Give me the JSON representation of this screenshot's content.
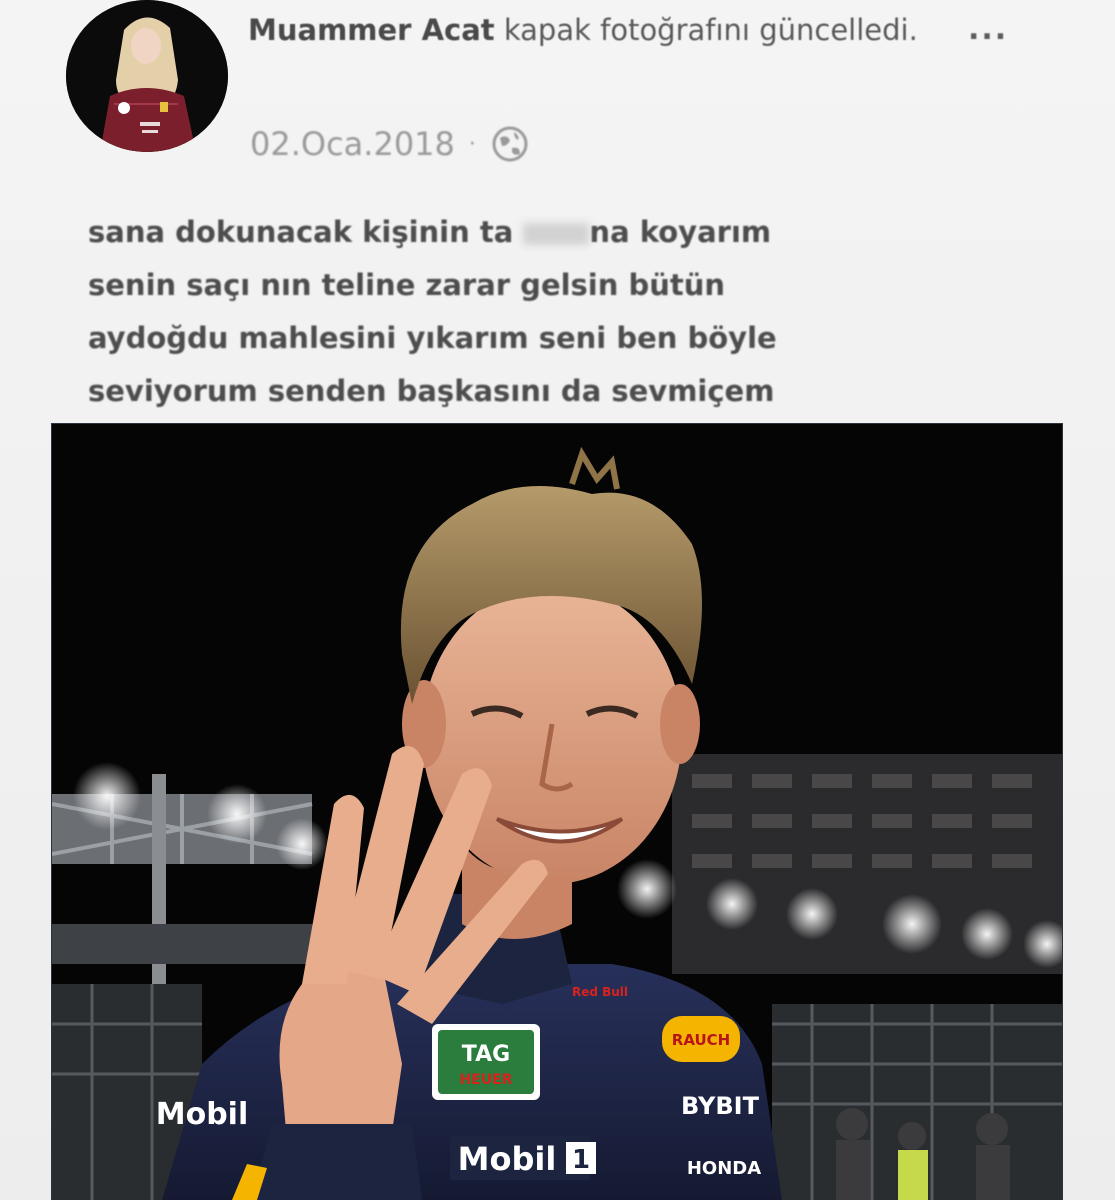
{
  "post": {
    "author": "Muammer Acat",
    "action": "kapak fotoğrafını güncelledi.",
    "more": "...",
    "date": "02.Oca.2018",
    "separator": "·",
    "audience_icon": "globe-icon",
    "text_lines": [
      "sana dokunacak kişinin ta",
      "na koyarım",
      "senin saçı nın teline zarar gelsin  bütün",
      "aydoğdu mahlesini  yıkarım seni ben böyle",
      "seviyorum senden başkasını da sevmiçem"
    ]
  },
  "photo": {
    "alt": "cover-photo",
    "suit_logos": {
      "tag": "TAG",
      "heuer": "HEUER",
      "mobil": "Mobil",
      "mobil_num": "1",
      "mobil_side": "Mobil",
      "rauch": "RAUCH",
      "bybit": "BYBIT",
      "honda": "HONDA",
      "redbull": "Red Bull"
    }
  },
  "colors": {
    "background": "#f2f2f2",
    "text": "#4d4d4d",
    "meta": "#9a9a9a",
    "suit_navy": "#1c2440",
    "photo_bg": "#050506"
  }
}
